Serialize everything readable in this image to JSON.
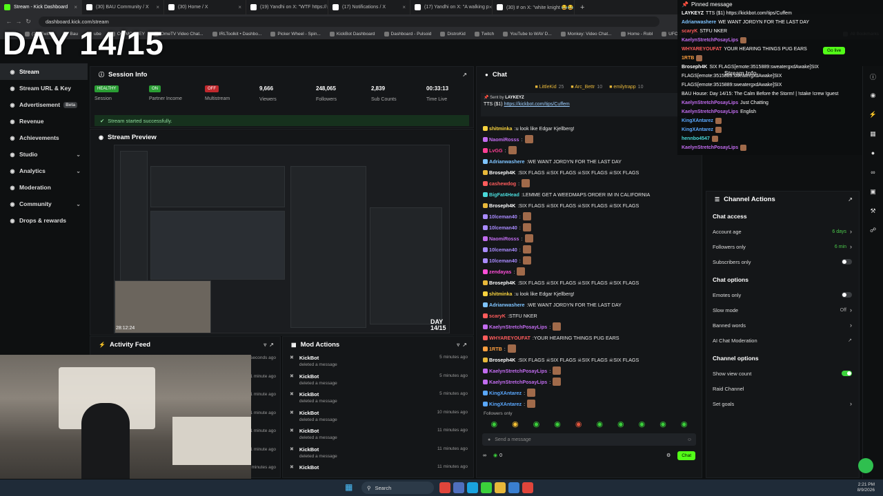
{
  "browser": {
    "tabs": [
      {
        "label": "Stream - Kick Dashboard",
        "color": "#53fc18",
        "active": true
      },
      {
        "label": "(30) BAU Community / X",
        "color": "#ffffff",
        "active": false
      },
      {
        "label": "(30) Home / X",
        "color": "#ffffff",
        "active": false
      },
      {
        "label": "(19) Yandhi on X: \"WTF https://",
        "color": "#ffffff",
        "active": false
      },
      {
        "label": "(17) Notifications / X",
        "color": "#ffffff",
        "active": false
      },
      {
        "label": "(17) Yandhi on X: \"A walking p",
        "color": "#ffffff",
        "active": false
      },
      {
        "label": "(30) # on X: \"white knight 😂😂",
        "color": "#ffffff",
        "active": false
      }
    ],
    "url": "dashboard.kick.com/stream",
    "bookmarks": [
      "(12) Twitter",
      "Bau",
      "ube",
      "OG MONKEY",
      "OmeTV Video Chat...",
      "IRLToolkit • Dashbo...",
      "Picker Wheel - Spin...",
      "KickBot Dashboard",
      "Dashboard - Pulsoid",
      "DistroKid",
      "Twitch",
      "YouTube to WAV D...",
      "Monkey: Video Chat...",
      "Home - Robl",
      "UFC 326: Holloway...",
      "All Bookmarks"
    ]
  },
  "overlay": {
    "day_counter": "DAY 14/15"
  },
  "sidebar": {
    "items": [
      {
        "label": "Stream",
        "icon": "broadcast-icon",
        "active": true,
        "chevron": false
      },
      {
        "label": "Stream URL & Key",
        "icon": "globe-icon",
        "active": false,
        "chevron": false
      },
      {
        "label": "Advertisement",
        "icon": "megaphone-icon",
        "active": false,
        "chevron": false,
        "badge": "Beta"
      },
      {
        "label": "Revenue",
        "icon": "money-icon",
        "active": false,
        "chevron": false
      },
      {
        "label": "Achievements",
        "icon": "trophy-icon",
        "active": false,
        "chevron": false
      },
      {
        "label": "Studio",
        "icon": "palette-icon",
        "active": false,
        "chevron": true
      },
      {
        "label": "Analytics",
        "icon": "chart-icon",
        "active": false,
        "chevron": true
      },
      {
        "label": "Moderation",
        "icon": "hammer-icon",
        "active": false,
        "chevron": false
      },
      {
        "label": "Community",
        "icon": "users-icon",
        "active": false,
        "chevron": true
      },
      {
        "label": "Drops & rewards",
        "icon": "gift-icon",
        "active": false,
        "chevron": false
      }
    ]
  },
  "session": {
    "title": "Session Info",
    "metrics": [
      {
        "badge": "HEALTHY",
        "badge_color": "#2a9d34",
        "label": "Session"
      },
      {
        "badge": "ON",
        "badge_color": "#2a9d34",
        "label": "Partner Income"
      },
      {
        "badge": "OFF",
        "badge_color": "#c0282d",
        "label": "Multistream"
      },
      {
        "value": "9,666",
        "label": "Viewers"
      },
      {
        "value": "248,065",
        "label": "Followers"
      },
      {
        "value": "2,839",
        "label": "Sub Counts"
      },
      {
        "value": "00:33:13",
        "label": "Time Live"
      }
    ],
    "status": "Stream started successfully."
  },
  "preview": {
    "title": "Stream Preview",
    "timestamp": "28:12:24",
    "overlay": "DAY 14/15"
  },
  "activity": {
    "title": "Activity Feed",
    "times": [
      "seconds ago",
      "1 minute ago",
      "1 minute ago",
      "1 minute ago",
      "1 minute ago",
      "1 minute ago",
      "minutes ago"
    ]
  },
  "mod_actions": {
    "title": "Mod Actions",
    "rows": [
      {
        "who": "KickBot",
        "what": "deleted a message",
        "when": "5 minutes ago"
      },
      {
        "who": "KickBot",
        "what": "deleted a message",
        "when": "5 minutes ago"
      },
      {
        "who": "KickBot",
        "what": "deleted a message",
        "when": "5 minutes ago"
      },
      {
        "who": "KickBot",
        "what": "deleted a message",
        "when": "10 minutes ago"
      },
      {
        "who": "KickBot",
        "what": "deleted a message",
        "when": "11 minutes ago"
      },
      {
        "who": "KickBot",
        "what": "deleted a message",
        "when": "11 minutes ago"
      },
      {
        "who": "KickBot",
        "what": "",
        "when": "11 minutes ago"
      }
    ]
  },
  "chat": {
    "title": "Chat",
    "top_gifters": [
      {
        "name": "LittleKid",
        "count": "25"
      },
      {
        "name": "Arc_Bettr",
        "count": "10"
      },
      {
        "name": "emilytrapp",
        "count": "10"
      }
    ],
    "pinned_sender": "Sent by",
    "pinned_user": "LAYKEYZ",
    "pinned_text": "TTS ($1) ",
    "pinned_link": "https://kickbot.com/tips/Cuffem",
    "messages": [
      {
        "user": "shitminka",
        "color": "#f7d23e",
        "text": "u look like Edgar Kjellberg!",
        "emote": false
      },
      {
        "user": "NaomiRosss",
        "color": "#c26cf0",
        "text": "",
        "emote": true
      },
      {
        "user": "LvGG",
        "color": "#ff3f94",
        "text": "",
        "emote": true
      },
      {
        "user": "Adrianwashere",
        "color": "#7fc4ff",
        "text": "WE WANT JORDYN FOR THE LAST DAY",
        "emote": false
      },
      {
        "user": "Broseph4K",
        "color": "#ffffff",
        "text": "SIX FLAGS ☠SIX FLAGS ☠SIX FLAGS ☠SIX FLAGS",
        "emote": true
      },
      {
        "user": "cashewdog",
        "color": "#ff5c5c",
        "text": "",
        "emote": true
      },
      {
        "user": "BigFat4Head",
        "color": "#4ad9d9",
        "text": "LEMME GET A WEEDMAPS ORDER IM IN CALIFORNIA",
        "emote": false
      },
      {
        "user": "Broseph4K",
        "color": "#ffffff",
        "text": "SIX FLAGS ☠SIX FLAGS ☠SIX FLAGS ☠SIX FLAGS",
        "emote": true
      },
      {
        "user": "10lceman40",
        "color": "#a98bff",
        "text": "",
        "emote": true
      },
      {
        "user": "10lceman40",
        "color": "#a98bff",
        "text": "",
        "emote": true
      },
      {
        "user": "NaomiRosss",
        "color": "#c26cf0",
        "text": "",
        "emote": true
      },
      {
        "user": "10lceman40",
        "color": "#a98bff",
        "text": "",
        "emote": true
      },
      {
        "user": "10lceman40",
        "color": "#a98bff",
        "text": "",
        "emote": true
      },
      {
        "user": "zendayas",
        "color": "#ff4fd8",
        "text": "",
        "emote": true
      },
      {
        "user": "Broseph4K",
        "color": "#ffffff",
        "text": "SIX FLAGS ☠SIX FLAGS ☠SIX FLAGS ☠SIX FLAGS",
        "emote": true
      },
      {
        "user": "shitminka",
        "color": "#f7d23e",
        "text": "u look like Edgar Kjellberg!",
        "emote": false
      },
      {
        "user": "Adrianwashere",
        "color": "#7fc4ff",
        "text": "WE WANT JORDYN FOR THE LAST DAY",
        "emote": false
      },
      {
        "user": "scaryK",
        "color": "#ff5c5c",
        "text": "STFU NKER",
        "emote": false
      },
      {
        "user": "KaelynStretchPosayLips",
        "color": "#c26cf0",
        "text": "",
        "emote": true
      },
      {
        "user": "WHYAREYOUFAT",
        "color": "#ff5c5c",
        "text": "YOUR HEARING THINGS PUG EARS",
        "emote": false
      },
      {
        "user": "1RTB",
        "color": "#ff9f3f",
        "text": "",
        "emote": true
      },
      {
        "user": "Broseph4K",
        "color": "#ffffff",
        "text": "SIX FLAGS ☠SIX FLAGS ☠SIX FLAGS ☠SIX FLAGS",
        "emote": true
      },
      {
        "user": "KaelynStretchPosayLips",
        "color": "#c26cf0",
        "text": "",
        "emote": true
      },
      {
        "user": "KaelynStretchPosayLips",
        "color": "#c26cf0",
        "text": "",
        "emote": true
      },
      {
        "user": "KingXAntarez",
        "color": "#5aa8ff",
        "text": "",
        "emote": true
      },
      {
        "user": "KingXAntarez",
        "color": "#5aa8ff",
        "text": "",
        "emote": true
      }
    ],
    "followers_only": "Followers only",
    "input_placeholder": "Send a message",
    "count": "0",
    "send_label": "Chat"
  },
  "pinned_overlay": {
    "title": "Pinned message",
    "lines": [
      {
        "user": "LAYKEYZ",
        "color": "#ffffff",
        "text": "TTS ($1) https://kickbot.com/tips/Cuffem"
      },
      {
        "user": "Adrianwashere",
        "color": "#7fc4ff",
        "text": "WE WANT JORDYN FOR THE LAST DAY"
      },
      {
        "user": "scaryK",
        "color": "#ff5c5c",
        "text": "STFU NKER"
      },
      {
        "user": "KaelynStretchPosayLips",
        "color": "#c26cf0",
        "text": ""
      },
      {
        "user": "WHYAREYOUFAT",
        "color": "#ff5c5c",
        "text": "YOUR HEARING THINGS PUG EARS"
      },
      {
        "user": "1RTB",
        "color": "#ff9f3f",
        "text": ""
      },
      {
        "user": "Broseph4K",
        "color": "#ffffff",
        "text": "SIX FLAGS[emote:3515889:sweatergxdAwake]SIX"
      },
      {
        "user": "",
        "color": "#ffffff",
        "text": "FLAGS[emote:3515889:sweatergxdAwake]SIX"
      },
      {
        "user": "",
        "color": "#ffffff",
        "text": "FLAGS[emote:3515889:sweatergxdAwake]SIX"
      },
      {
        "user": "",
        "color": "#ffffff",
        "text": "BAU House: Day 14/15: The Calm Before the Storm! | !stake !crew !guest"
      },
      {
        "user": "KaelynStretchPosayLips",
        "color": "#c26cf0",
        "text": "Just Chatting"
      },
      {
        "user": "KaelynStretchPosayLips",
        "color": "#c26cf0",
        "text": "English"
      },
      {
        "user": "KingXAntarez",
        "color": "#5aa8ff",
        "text": ""
      },
      {
        "user": "KingXAntarez",
        "color": "#5aa8ff",
        "text": ""
      },
      {
        "user": "hennbo4547",
        "color": "#4ad9d9",
        "text": ""
      },
      {
        "user": "KaelynStretchPosayLips",
        "color": "#c26cf0",
        "text": ""
      }
    ],
    "go_live": "Go live",
    "stream_info": "Stream Info"
  },
  "channel_actions": {
    "title": "Channel Actions",
    "rows": [
      {
        "type": "header",
        "label": "Chat access"
      },
      {
        "type": "link",
        "label": "Account age",
        "value": "6 days"
      },
      {
        "type": "link",
        "label": "Followers only",
        "value": "6 min"
      },
      {
        "type": "toggle",
        "label": "Subscribers only",
        "on": false
      },
      {
        "type": "header",
        "label": "Chat options"
      },
      {
        "type": "toggle",
        "label": "Emotes only",
        "on": false
      },
      {
        "type": "link",
        "label": "Slow mode",
        "value": "Off",
        "grey": true
      },
      {
        "type": "link",
        "label": "Banned words",
        "value": ""
      },
      {
        "type": "ext",
        "label": "AI Chat Moderation"
      },
      {
        "type": "header",
        "label": "Channel options"
      },
      {
        "type": "toggle",
        "label": "Show view count",
        "on": true
      },
      {
        "type": "plain",
        "label": "Raid Channel"
      },
      {
        "type": "link",
        "label": "Set goals",
        "value": ""
      }
    ]
  },
  "taskbar": {
    "search": "Search",
    "time": "2:21 PM",
    "date": "8/9/2026"
  }
}
